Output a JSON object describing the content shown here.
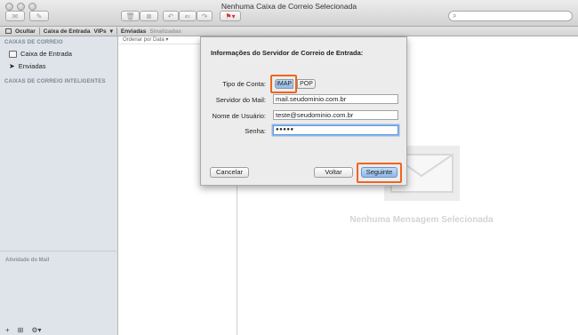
{
  "window": {
    "title": "Nenhuma Caixa de Correio Selecionada"
  },
  "search": {
    "icon": "search-icon",
    "value": ""
  },
  "favorites": {
    "hide_label": "Ocultar",
    "inbox_label": "Caixa de Entrada",
    "vips_label": "VIPs",
    "sent_label": "Enviadas",
    "drafts_label": "Sinalizadas"
  },
  "sidebar": {
    "mailboxes_heading": "CAIXAS DE CORREIO",
    "items": [
      {
        "label": "Caixa de Entrada",
        "icon": "inbox-icon"
      },
      {
        "label": "Enviadas",
        "icon": "sent-icon"
      }
    ],
    "smart_heading": "CAIXAS DE CORREIO INTELIGENTES",
    "activity_label": "Atividade do Mail",
    "footer": {
      "add": "+",
      "mailbox": "⊞",
      "gear": "⚙▾"
    }
  },
  "message_list": {
    "sort_label": "Ordenar por Data ▾"
  },
  "preview": {
    "empty_label": "Nenhuma Mensagem Selecionada"
  },
  "dialog": {
    "title": "Informações do Servidor de Correio de Entrada:",
    "account_type_label": "Tipo de Conta:",
    "account_type_options": [
      "IMAP",
      "POP"
    ],
    "account_type_selected": "IMAP",
    "mail_server_label": "Servidor do Mail:",
    "mail_server_value": "mail.seudominio.com.br",
    "username_label": "Nome de Usuário:",
    "username_value": "teste@seudominio.com.br",
    "password_label": "Senha:",
    "password_value": "●●●●●",
    "cancel_label": "Cancelar",
    "back_label": "Voltar",
    "next_label": "Seguinte"
  },
  "colors": {
    "highlight": "#f0641e",
    "primary_button": "#8cb8ea",
    "sidebar_bg": "#dfe4ea"
  }
}
